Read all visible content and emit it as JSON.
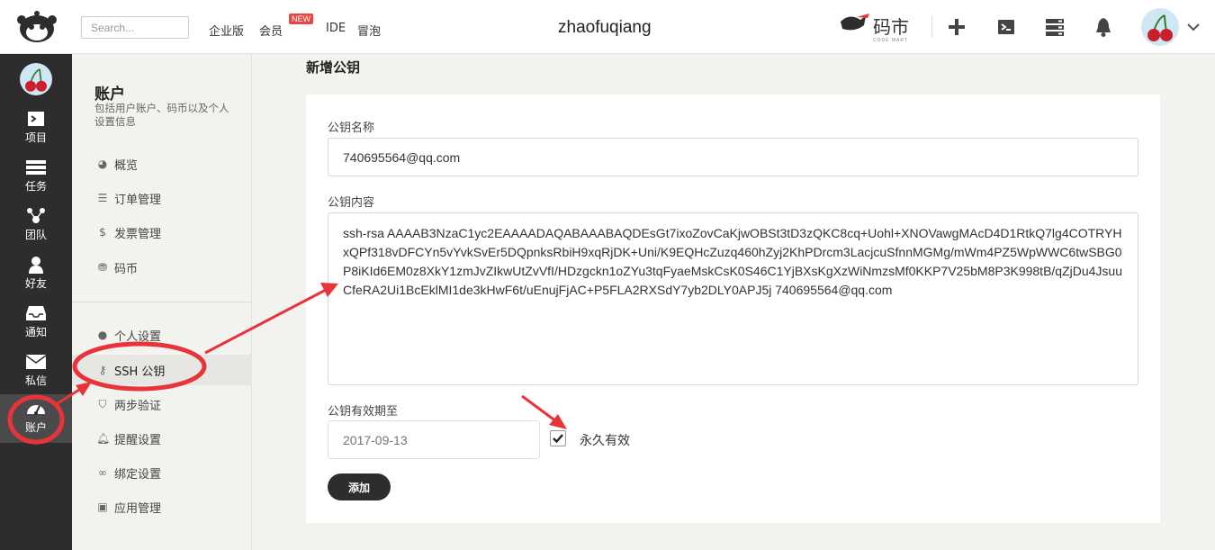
{
  "topbar": {
    "search_placeholder": "Search...",
    "nav": [
      "企业版",
      "会员",
      "IDE",
      "冒泡"
    ],
    "new_badge": "NEW",
    "username": "zhaofuqiang",
    "coin_brand": "码市",
    "coin_sub": "CODE MART"
  },
  "sidebar": {
    "items": [
      {
        "label": "项目",
        "icon": "project-icon"
      },
      {
        "label": "任务",
        "icon": "task-icon"
      },
      {
        "label": "团队",
        "icon": "team-icon"
      },
      {
        "label": "好友",
        "icon": "friend-icon"
      },
      {
        "label": "通知",
        "icon": "inbox-icon"
      },
      {
        "label": "私信",
        "icon": "mail-icon"
      },
      {
        "label": "账户",
        "icon": "dashboard-icon"
      }
    ]
  },
  "menu": {
    "title": "账户",
    "desc": "包括用户账户、码币以及个人设置信息",
    "group1": [
      {
        "label": "概览",
        "icon": "dashboard-icon"
      },
      {
        "label": "订单管理",
        "icon": "list-icon"
      },
      {
        "label": "发票管理",
        "icon": "dollar-icon"
      },
      {
        "label": "码币",
        "icon": "coins-icon"
      }
    ],
    "group2": [
      {
        "label": "个人设置",
        "icon": "user-icon"
      },
      {
        "label": "SSH 公钥",
        "icon": "key-icon"
      },
      {
        "label": "两步验证",
        "icon": "shield-icon"
      },
      {
        "label": "提醒设置",
        "icon": "bell-icon"
      },
      {
        "label": "绑定设置",
        "icon": "link-icon"
      },
      {
        "label": "应用管理",
        "icon": "briefcase-icon"
      }
    ]
  },
  "form": {
    "page_title": "新增公钥",
    "name_label": "公钥名称",
    "name_value": "740695564@qq.com",
    "content_label": "公钥内容",
    "content_value": "ssh-rsa AAAAB3NzaC1yc2EAAAADAQABAAABAQDEsGt7ixoZovCaKjwOBSt3tD3zQKC8cq+Uohl+XNOVawgMAcD4D1RtkQ7lg4COTRYHxQPf318vDFCYn5vYvkSvEr5DQpnksRbiH9xqRjDK+Uni/K9EQHcZuzq460hZyj2KhPDrcm3LacjcuSfnnMGMg/mWm4PZ5WpWWC6twSBG0P8iKId6EM0z8XkY1zmJvZIkwUtZvVfI/HDzgckn1oZYu3tqFyaeMskCsK0S46C1YjBXsKgXzWiNmzsMf0KKP7V25bM8P3K998tB/qZjDu4JsuuCfeRA2Ui1BcEklMI1de3kHwF6t/uEnujFjAC+P5FLA2RXSdY7yb2DLY0APJ5j 740695564@qq.com",
    "expiry_label": "公钥有效期至",
    "expiry_placeholder": "2017-09-13",
    "permanent_label": "永久有效",
    "permanent_checked": true,
    "submit_label": "添加"
  },
  "colors": {
    "sidebar_bg": "#2d2d2d",
    "annotation_red": "#e8333a",
    "button_bg": "#2d2d2d"
  }
}
